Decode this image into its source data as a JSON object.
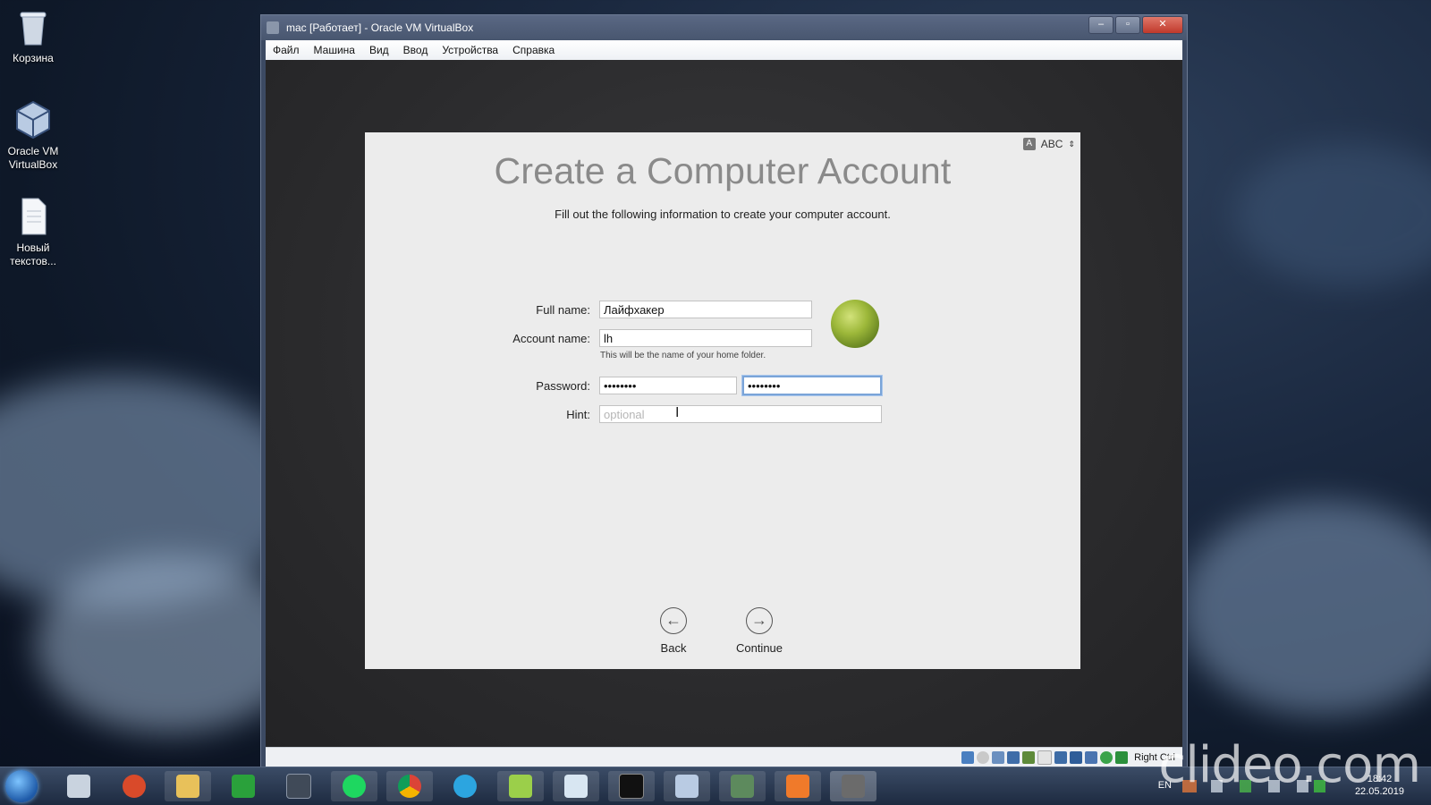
{
  "desktop": {
    "icons": [
      {
        "label": "Корзина"
      },
      {
        "label": "Oracle VM VirtualBox"
      },
      {
        "label": "Новый текстов..."
      }
    ]
  },
  "vbox_window": {
    "title": "mac [Работает] - Oracle VM VirtualBox",
    "menu": [
      "Файл",
      "Машина",
      "Вид",
      "Ввод",
      "Устройства",
      "Справка"
    ],
    "statusbar_host_key": "Right Ctrl"
  },
  "setup": {
    "title": "Create a Computer Account",
    "subtitle": "Fill out the following information to create your computer account.",
    "input_source": "ABC",
    "full_name_label": "Full name:",
    "full_name_value": "Лайфхакер",
    "account_name_label": "Account name:",
    "account_name_value": "lh",
    "account_note": "This will be the name of your home folder.",
    "password_label": "Password:",
    "password_value": "••••••••",
    "verify_value": "••••••••",
    "hint_label": "Hint:",
    "hint_placeholder": "optional",
    "back_label": "Back",
    "continue_label": "Continue"
  },
  "taskbar": {
    "language": "EN",
    "time": "18:42",
    "date": "22.05.2019"
  },
  "watermark": "clideo.com"
}
